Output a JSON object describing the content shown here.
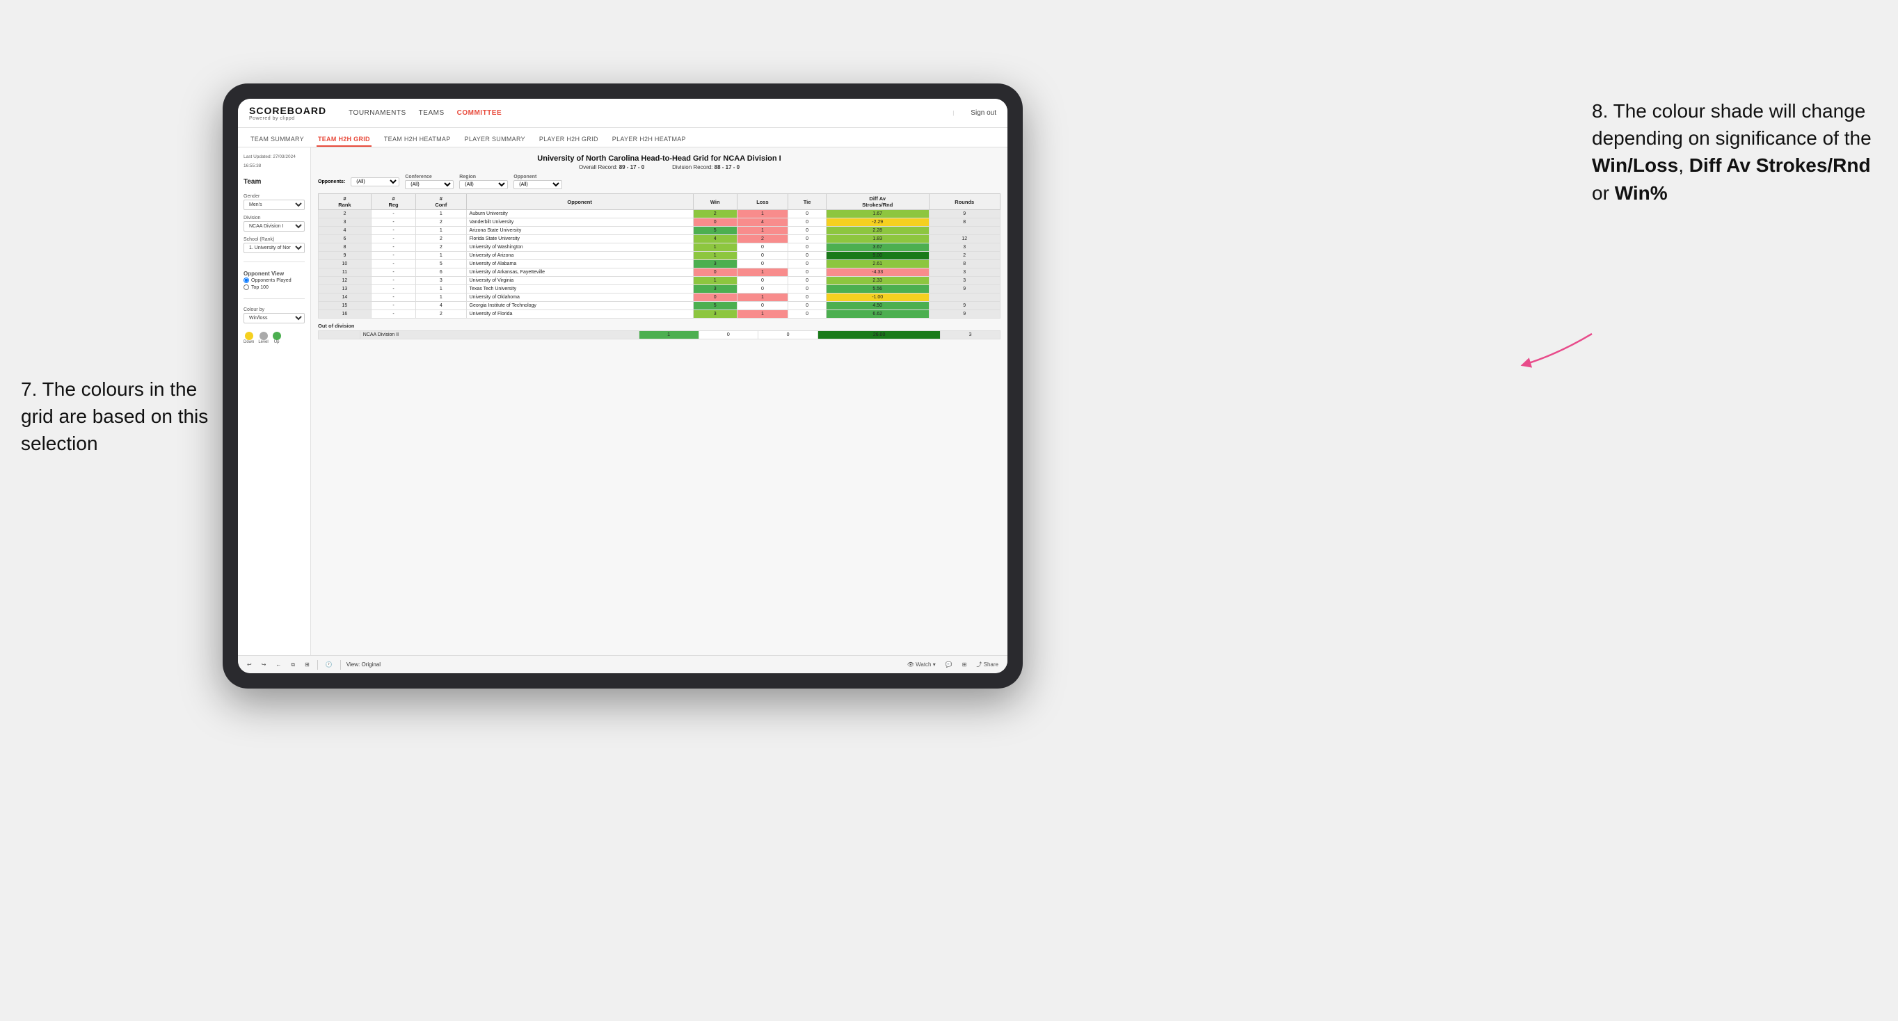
{
  "page": {
    "background": "#f0f0f0"
  },
  "annotation_left": {
    "number": "7.",
    "text": "The colours in the grid are based on this selection"
  },
  "annotation_right": {
    "number": "8.",
    "text1": "The colour shade will change depending on significance of the ",
    "bold1": "Win/Loss",
    "text2": ", ",
    "bold2": "Diff Av Strokes/Rnd",
    "text3": " or ",
    "bold3": "Win%"
  },
  "app": {
    "logo": "SCOREBOARD",
    "logo_sub": "Powered by clippd",
    "nav": [
      "TOURNAMENTS",
      "TEAMS",
      "COMMITTEE"
    ],
    "sign_out": "Sign out",
    "sub_nav": [
      "TEAM SUMMARY",
      "TEAM H2H GRID",
      "TEAM H2H HEATMAP",
      "PLAYER SUMMARY",
      "PLAYER H2H GRID",
      "PLAYER H2H HEATMAP"
    ]
  },
  "sidebar": {
    "last_updated_label": "Last Updated: 27/03/2024",
    "time": "16:55:38",
    "team_label": "Team",
    "gender_label": "Gender",
    "gender_value": "Men's",
    "division_label": "Division",
    "division_value": "NCAA Division I",
    "school_label": "School (Rank)",
    "school_value": "1. University of Nort...",
    "opponent_view_label": "Opponent View",
    "radio1": "Opponents Played",
    "radio2": "Top 100",
    "colour_by_label": "Colour by",
    "colour_by_value": "Win/loss",
    "legend_down": "Down",
    "legend_level": "Level",
    "legend_up": "Up"
  },
  "grid": {
    "title": "University of North Carolina Head-to-Head Grid for NCAA Division I",
    "overall_record_label": "Overall Record:",
    "overall_record": "89 - 17 - 0",
    "division_record_label": "Division Record:",
    "division_record": "88 - 17 - 0",
    "filters": {
      "opponents_label": "Opponents:",
      "opponents_value": "(All)",
      "conference_label": "Conference",
      "conference_value": "(All)",
      "region_label": "Region",
      "region_value": "(All)",
      "opponent_label": "Opponent",
      "opponent_value": "(All)"
    },
    "col_headers": [
      "#\nRank",
      "#\nReg",
      "#\nConf",
      "Opponent",
      "Win",
      "Loss",
      "Tie",
      "Diff Av\nStrokes/Rnd",
      "Rounds"
    ],
    "rows": [
      {
        "rank": "2",
        "reg": "-",
        "conf": "1",
        "opponent": "Auburn University",
        "win": "2",
        "loss": "1",
        "tie": "0",
        "diff": "1.67",
        "rounds": "9",
        "win_color": "bg-green-light",
        "diff_color": "bg-green-light"
      },
      {
        "rank": "3",
        "reg": "-",
        "conf": "2",
        "opponent": "Vanderbilt University",
        "win": "0",
        "loss": "4",
        "tie": "0",
        "diff": "-2.29",
        "rounds": "8",
        "win_color": "bg-red-light",
        "diff_color": "bg-yellow"
      },
      {
        "rank": "4",
        "reg": "-",
        "conf": "1",
        "opponent": "Arizona State University",
        "win": "5",
        "loss": "1",
        "tie": "0",
        "diff": "2.28",
        "rounds": "",
        "win_color": "bg-green-medium",
        "diff_color": "bg-green-light"
      },
      {
        "rank": "6",
        "reg": "-",
        "conf": "2",
        "opponent": "Florida State University",
        "win": "4",
        "loss": "2",
        "tie": "0",
        "diff": "1.83",
        "rounds": "12",
        "win_color": "bg-green-light",
        "diff_color": "bg-green-light"
      },
      {
        "rank": "8",
        "reg": "-",
        "conf": "2",
        "opponent": "University of Washington",
        "win": "1",
        "loss": "0",
        "tie": "0",
        "diff": "3.67",
        "rounds": "3",
        "win_color": "bg-green-light",
        "diff_color": "bg-green-medium"
      },
      {
        "rank": "9",
        "reg": "-",
        "conf": "1",
        "opponent": "University of Arizona",
        "win": "1",
        "loss": "0",
        "tie": "0",
        "diff": "9.00",
        "rounds": "2",
        "win_color": "bg-green-light",
        "diff_color": "bg-green-dark"
      },
      {
        "rank": "10",
        "reg": "-",
        "conf": "5",
        "opponent": "University of Alabama",
        "win": "3",
        "loss": "0",
        "tie": "0",
        "diff": "2.61",
        "rounds": "8",
        "win_color": "bg-green-medium",
        "diff_color": "bg-green-light"
      },
      {
        "rank": "11",
        "reg": "-",
        "conf": "6",
        "opponent": "University of Arkansas, Fayetteville",
        "win": "0",
        "loss": "1",
        "tie": "0",
        "diff": "-4.33",
        "rounds": "3",
        "win_color": "bg-red-light",
        "diff_color": "bg-red-light"
      },
      {
        "rank": "12",
        "reg": "-",
        "conf": "3",
        "opponent": "University of Virginia",
        "win": "1",
        "loss": "0",
        "tie": "0",
        "diff": "2.33",
        "rounds": "3",
        "win_color": "bg-green-light",
        "diff_color": "bg-green-light"
      },
      {
        "rank": "13",
        "reg": "-",
        "conf": "1",
        "opponent": "Texas Tech University",
        "win": "3",
        "loss": "0",
        "tie": "0",
        "diff": "5.56",
        "rounds": "9",
        "win_color": "bg-green-medium",
        "diff_color": "bg-green-medium"
      },
      {
        "rank": "14",
        "reg": "-",
        "conf": "1",
        "opponent": "University of Oklahoma",
        "win": "0",
        "loss": "1",
        "tie": "0",
        "diff": "-1.00",
        "rounds": "",
        "win_color": "bg-red-light",
        "diff_color": "bg-yellow"
      },
      {
        "rank": "15",
        "reg": "-",
        "conf": "4",
        "opponent": "Georgia Institute of Technology",
        "win": "5",
        "loss": "0",
        "tie": "0",
        "diff": "4.50",
        "rounds": "9",
        "win_color": "bg-green-medium",
        "diff_color": "bg-green-medium"
      },
      {
        "rank": "16",
        "reg": "-",
        "conf": "2",
        "opponent": "University of Florida",
        "win": "3",
        "loss": "1",
        "tie": "0",
        "diff": "6.62",
        "rounds": "9",
        "win_color": "bg-green-light",
        "diff_color": "bg-green-medium"
      }
    ],
    "out_of_division_label": "Out of division",
    "out_of_division_row": {
      "division": "NCAA Division II",
      "win": "1",
      "loss": "0",
      "tie": "0",
      "diff": "26.00",
      "rounds": "3",
      "win_color": "bg-green-medium",
      "diff_color": "bg-green-dark"
    }
  },
  "toolbar": {
    "view_label": "View: Original",
    "watch_label": "Watch",
    "share_label": "Share"
  }
}
